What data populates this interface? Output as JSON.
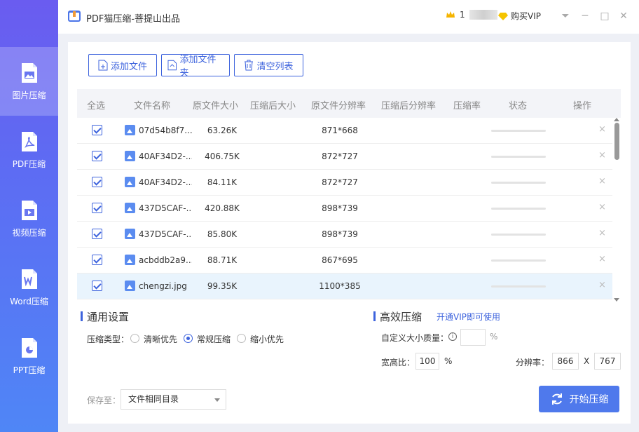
{
  "app": {
    "title": "PDF猫压缩-菩提山出品"
  },
  "user": {
    "name_prefix": "1",
    "name_suffix": ".",
    "vip_label": "购买VIP"
  },
  "window": {
    "minimize_glyph": "─",
    "maximize_glyph": "□",
    "close_glyph": "✕",
    "menu_glyph": "⏷"
  },
  "sidebar": {
    "items": [
      {
        "label": "图片压缩",
        "icon": "image-file-icon",
        "active": true
      },
      {
        "label": "PDF压缩",
        "icon": "pdf-file-icon",
        "active": false
      },
      {
        "label": "视频压缩",
        "icon": "video-file-icon",
        "active": false
      },
      {
        "label": "Word压缩",
        "icon": "word-file-icon",
        "active": false
      },
      {
        "label": "PPT压缩",
        "icon": "ppt-file-icon",
        "active": false
      }
    ]
  },
  "toolbar": {
    "add_file": "添加文件",
    "add_folder": "添加文件夹",
    "clear_list": "清空列表"
  },
  "table": {
    "columns": [
      "全选",
      "文件名称",
      "原文件大小",
      "压缩后大小",
      "原文件分辨率",
      "压缩后分辨率",
      "压缩率",
      "状态",
      "操作"
    ],
    "rows": [
      {
        "name": "07d54b8f7...",
        "size": "63.26K",
        "resolution": "871*668",
        "delete": "×"
      },
      {
        "name": "40AF34D2-...",
        "size": "406.75K",
        "resolution": "872*727",
        "delete": "×"
      },
      {
        "name": "40AF34D2-...",
        "size": "84.11K",
        "resolution": "872*727",
        "delete": "×"
      },
      {
        "name": "437D5CAF-...",
        "size": "420.88K",
        "resolution": "898*739",
        "delete": "×"
      },
      {
        "name": "437D5CAF-...",
        "size": "85.80K",
        "resolution": "898*739",
        "delete": "×"
      },
      {
        "name": "acbddb2a9...",
        "size": "88.71K",
        "resolution": "867*695",
        "delete": "×"
      },
      {
        "name": "chengzi.jpg",
        "size": "99.35K",
        "resolution": "1100*385",
        "delete": "×"
      }
    ]
  },
  "general_settings": {
    "title": "通用设置",
    "type_label": "压缩类型：",
    "options": [
      "清晰优先",
      "常规压缩",
      "缩小优先"
    ],
    "selected": "常规压缩"
  },
  "efficient": {
    "title": "高效压缩",
    "vip_link": "开通VIP即可使用",
    "quality_label": "自定义大小质量：",
    "quality_value": "",
    "quality_unit": "%",
    "ratio_label": "宽高比：",
    "ratio_value": "100",
    "ratio_unit": "%",
    "resolution_label": "分辨率：",
    "res_w": "866",
    "res_sep": "X",
    "res_h": "767"
  },
  "save": {
    "label": "保存至：",
    "value": "文件相同目录"
  },
  "start_button": "开始压缩",
  "colors": {
    "accent": "#3d63dd",
    "button": "#4f79ec"
  }
}
